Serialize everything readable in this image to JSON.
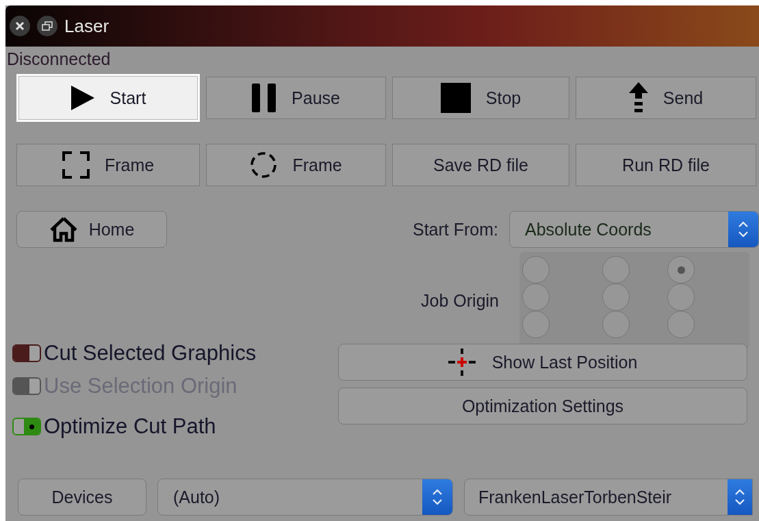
{
  "window": {
    "title": "Laser"
  },
  "status": "Disconnected",
  "control_buttons": [
    {
      "label": "Start",
      "focused": true
    },
    {
      "label": "Pause",
      "focused": false
    },
    {
      "label": "Stop",
      "focused": false
    },
    {
      "label": "Send",
      "focused": false
    }
  ],
  "file_buttons": [
    {
      "label": "Frame"
    },
    {
      "label": "Frame"
    },
    {
      "label": "Save RD file"
    },
    {
      "label": "Run RD file"
    }
  ],
  "home_button": {
    "label": "Home"
  },
  "start_from": {
    "label": "Start From:",
    "value": "Absolute Coords"
  },
  "job_origin": {
    "label": "Job Origin",
    "options": [
      {
        "selected": false
      },
      {
        "selected": false
      },
      {
        "selected": true
      },
      {
        "selected": false
      },
      {
        "selected": false
      },
      {
        "selected": false
      },
      {
        "selected": false
      },
      {
        "selected": false
      },
      {
        "selected": false
      }
    ]
  },
  "options": [
    {
      "label": "Cut Selected Graphics",
      "checked": false,
      "disabled": false,
      "color": "#4a1c1c"
    },
    {
      "label": "Use Selection Origin",
      "checked": false,
      "disabled": true,
      "color": "#555555"
    },
    {
      "label": "Optimize Cut Path",
      "checked": true,
      "disabled": false,
      "color": "#2e8a12"
    }
  ],
  "show_last_position": {
    "label": "Show Last Position"
  },
  "optimization_settings": {
    "label": "Optimization Settings"
  },
  "devices_button": {
    "label": "Devices"
  },
  "port_select": {
    "value": "(Auto)"
  },
  "device_select": {
    "value": "FrankenLaserTorbenSteir"
  }
}
